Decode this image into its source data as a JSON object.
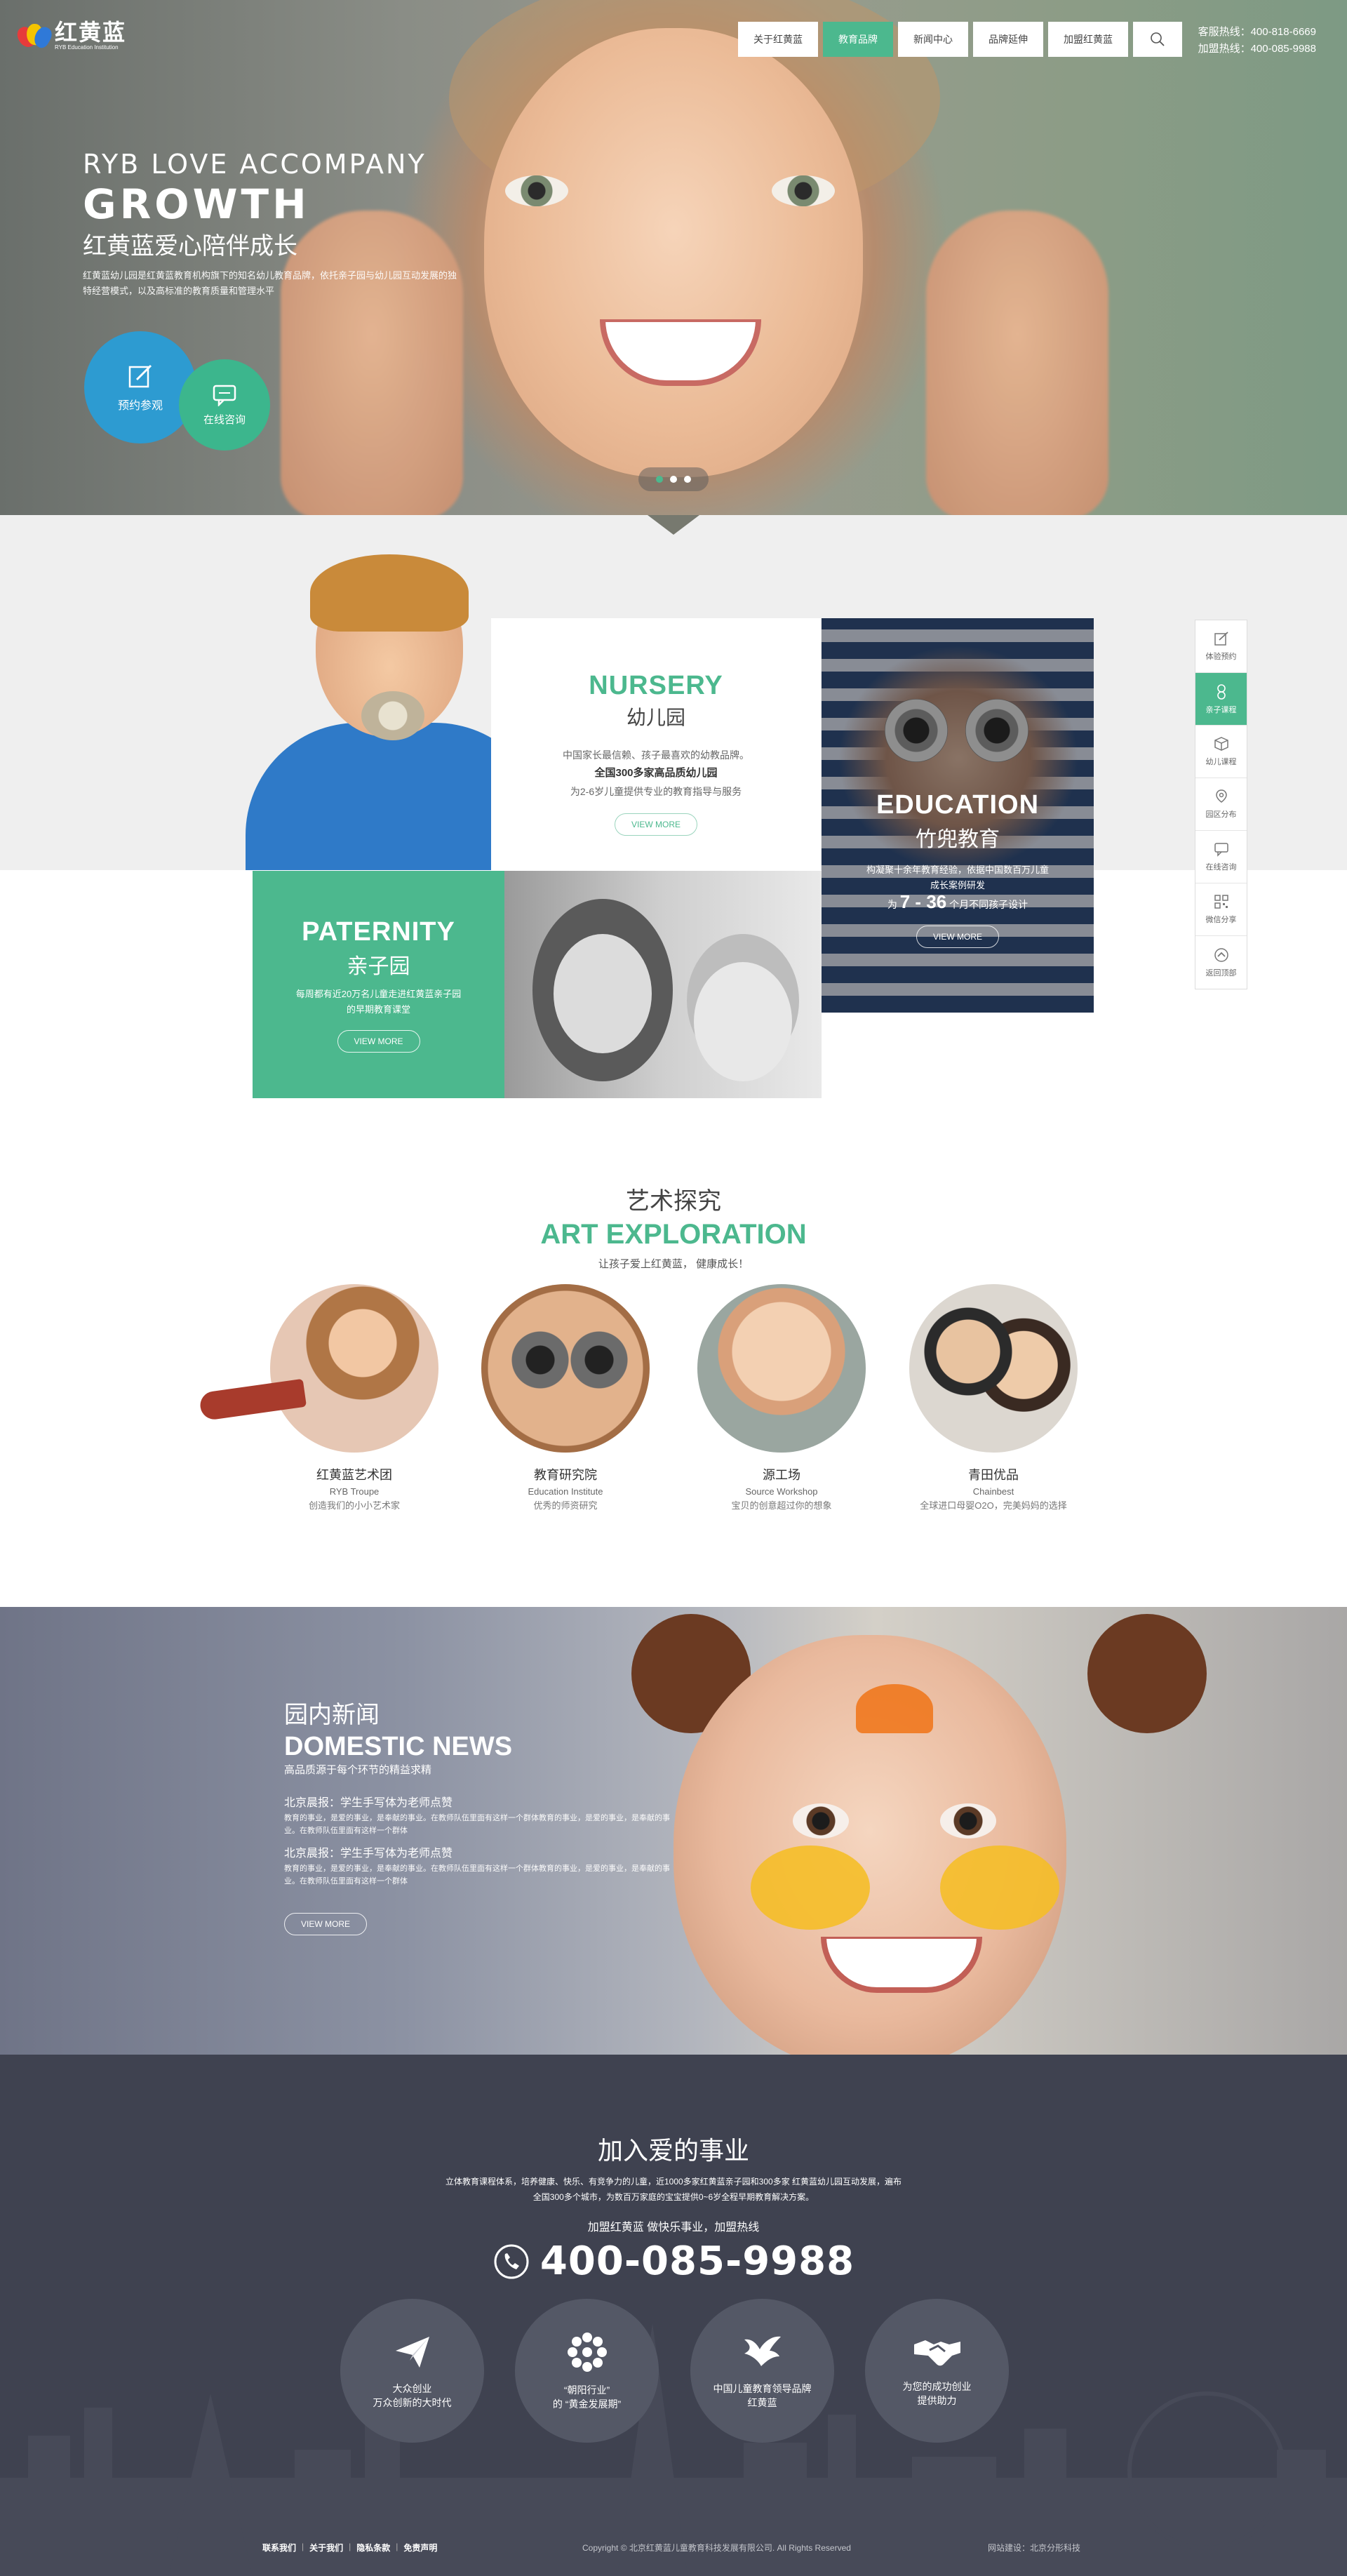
{
  "header": {
    "logo": {
      "cn": "红黄蓝",
      "en": "RYB Education Institution"
    },
    "nav": [
      "关于红黄蓝",
      "教育品牌",
      "新闻中心",
      "品牌延伸",
      "加盟红黄蓝"
    ],
    "nav_active_index": 1,
    "hotline_customer": "客服热线：400-818-6669",
    "hotline_join": "加盟热线：400-085-9988"
  },
  "hero": {
    "en_line1": "RYB LOVE ACCOMPANY",
    "en_line2": "GROWTH",
    "cn_title": "红黄蓝爱心陪伴成长",
    "desc": "红黄蓝幼儿园是红黄蓝教育机构旗下的知名幼儿教育品牌，依托亲子园与幼儿园互动发展的独特经营模式，以及高标准的教育质量和管理水平",
    "btn_visit": "预约参观",
    "btn_consult": "在线咨询",
    "slides_active": 1
  },
  "brands": {
    "nursery": {
      "en": "NURSERY",
      "cn": "幼儿园",
      "p1": "中国家长最信赖、孩子最喜欢的幼教品牌。",
      "p2": "全国300多家高品质幼儿园",
      "p3": "为2-6岁儿童提供专业的教育指导与服务",
      "btn": "VIEW MORE"
    },
    "education": {
      "en": "EDUCATION",
      "cn": "竹兜教育",
      "p1": "构凝聚十余年教育经验，依据中国数百万儿童成长案例研发",
      "p2_pre": "为",
      "p2_big": "7 - 36",
      "p2_post": "个月不同孩子设计",
      "btn": "VIEW MORE"
    },
    "paternity": {
      "en": "PATERNITY",
      "cn": "亲子园",
      "p1": "每周都有近20万名儿童走进红黄蓝亲子园的早期教育课堂",
      "btn": "VIEW MORE"
    }
  },
  "sidebar": [
    {
      "label": "体验预约",
      "icon": "edit-icon"
    },
    {
      "label": "亲子课程",
      "icon": "baby-icon",
      "active": true
    },
    {
      "label": "幼儿课程",
      "icon": "cube-icon"
    },
    {
      "label": "园区分布",
      "icon": "map-pin-icon"
    },
    {
      "label": "在线咨询",
      "icon": "chat-icon"
    },
    {
      "label": "微信分享",
      "icon": "qrcode-icon"
    },
    {
      "label": "返回顶部",
      "icon": "arrow-up-icon"
    }
  ],
  "art": {
    "cn": "艺术探究",
    "en": "ART EXPLORATION",
    "sub": "让孩子爱上红黄蓝， 健康成长！",
    "items": [
      {
        "cn": "红黄蓝艺术团",
        "en": "RYB Troupe",
        "desc": "创造我们的小小艺术家"
      },
      {
        "cn": "教育研究院",
        "en": "Education Institute",
        "desc": "优秀的师资研究"
      },
      {
        "cn": "源工场",
        "en": "Source Workshop",
        "desc": "宝贝的创意超过你的想象"
      },
      {
        "cn": "青田优品",
        "en": "Chainbest",
        "desc": "全球进口母婴O2O，完美妈妈的选择"
      }
    ]
  },
  "news": {
    "cn": "园内新闻",
    "en": "DOMESTIC NEWS",
    "sub": "高品质源于每个环节的精益求精",
    "items": [
      {
        "title": "北京晨报：学生手写体为老师点赞",
        "body": "教育的事业，是爱的事业，是奉献的事业。在教师队伍里面有这样一个群体教育的事业，是爱的事业，是奉献的事业。在教师队伍里面有这样一个群体"
      },
      {
        "title": "北京晨报：学生手写体为老师点赞",
        "body": "教育的事业，是爱的事业，是奉献的事业。在教师队伍里面有这样一个群体教育的事业，是爱的事业，是奉献的事业。在教师队伍里面有这样一个群体"
      }
    ],
    "btn": "VIEW MORE"
  },
  "join": {
    "title": "加入爱的事业",
    "desc1": "立体教育课程体系，培养健康、快乐、有竞争力的儿童，近1000多家红黄蓝亲子园和300多家 红黄蓝幼儿园互动发展，遍布",
    "desc2": "全国300多个城市，为数百万家庭的宝宝提供0~6岁全程早期教育解决方案。",
    "slogan": "加盟红黄蓝 做快乐事业，加盟热线",
    "phone": "400-085-9988",
    "circles": [
      {
        "l1": "大众创业",
        "l2": "万众创新的大时代",
        "icon": "paper-plane-icon"
      },
      {
        "l1": "“朝阳行业”",
        "l2": "的 “黄金发展期”",
        "icon": "sun-icon"
      },
      {
        "l1": "中国儿童教育领导品牌",
        "l2": "红黄蓝",
        "icon": "bird-icon"
      },
      {
        "l1": "为您的成功创业",
        "l2": "提供助力",
        "icon": "handshake-icon"
      }
    ]
  },
  "footer": {
    "links": [
      "联系我们",
      "关于我们",
      "隐私条款",
      "免责声明"
    ],
    "copyright": "Copyright © 北京红黄蓝儿童教育科技发展有限公司. All Rights Reserved",
    "built_by": "网站建设：北京分形科技"
  },
  "colors": {
    "accent_green": "#4cb88e",
    "accent_blue": "#2d9bd1",
    "join_bg": "#3f4250"
  }
}
